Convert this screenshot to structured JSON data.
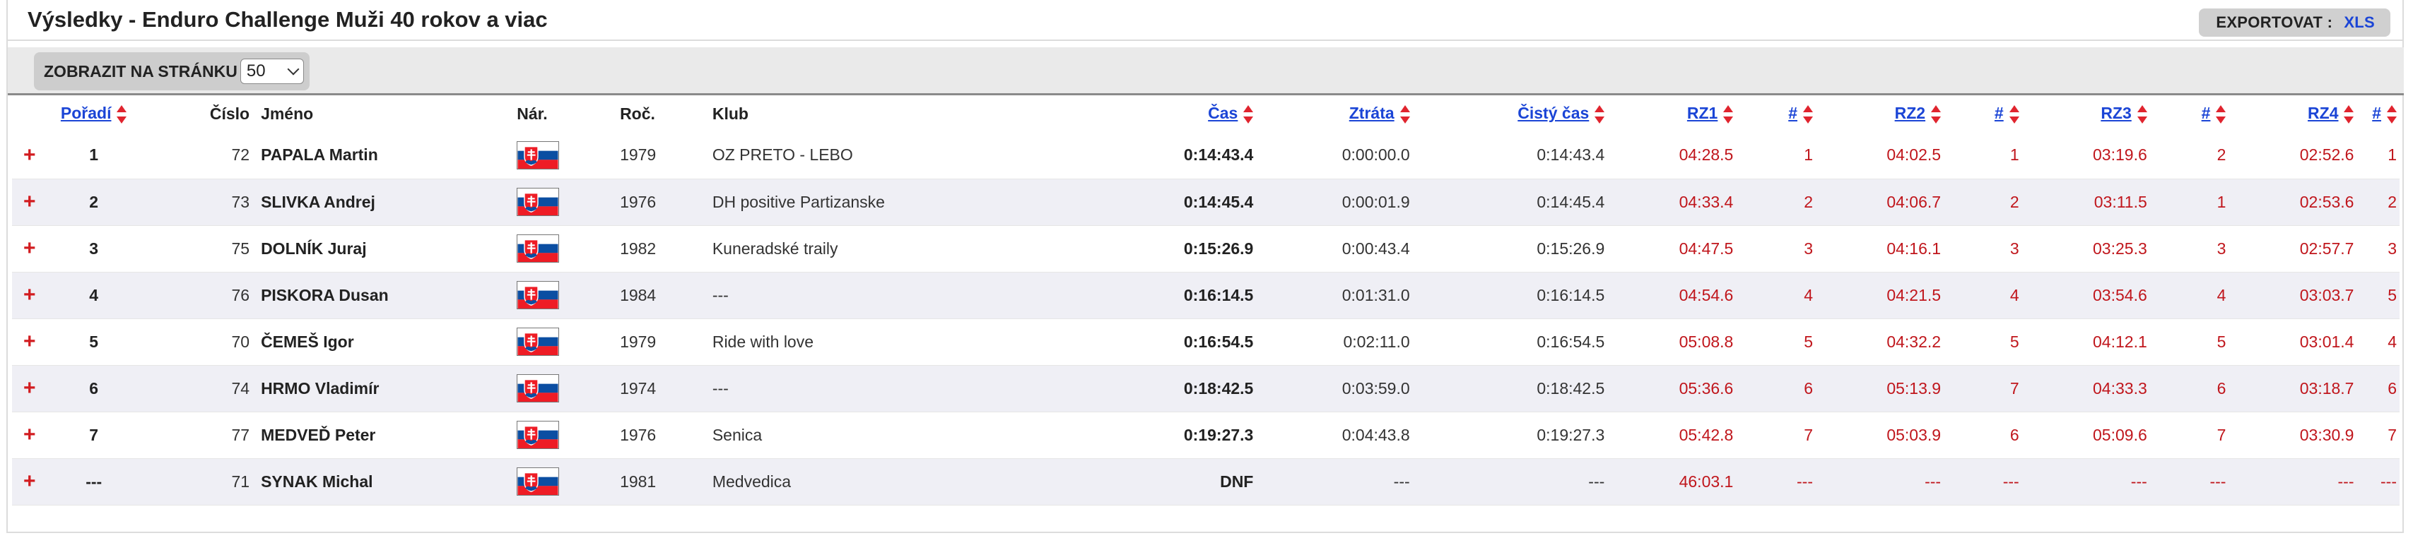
{
  "page": {
    "title": "Výsledky - Enduro Challenge Muži 40 rokov a viac"
  },
  "export": {
    "label": "EXPORTOVAT :",
    "xls": "XLS"
  },
  "toolbar": {
    "perpage_label": "ZOBRAZIT NA STRÁNKU",
    "perpage_value": "50"
  },
  "columns": {
    "poradi": "Pořadí",
    "cislo": "Číslo",
    "jmeno": "Jméno",
    "nar": "Nár.",
    "roc": "Roč.",
    "klub": "Klub",
    "cas": "Čas",
    "ztrata": "Ztráta",
    "cisty": "Čistý čas",
    "rz1": "RZ1",
    "rz2": "RZ2",
    "rz3": "RZ3",
    "rz4": "RZ4",
    "hash": "#"
  },
  "expand_symbol": "+",
  "rows": [
    {
      "rank": "1",
      "number": "72",
      "name": "PAPALA Martin",
      "nat": "svk-flag",
      "year": "1979",
      "club": "OZ PRETO - LEBO",
      "time": "0:14:43.4",
      "loss": "0:00:00.0",
      "clean": "0:14:43.4",
      "rz1": "04:28.5",
      "p1": "1",
      "rz2": "04:02.5",
      "p2": "1",
      "rz3": "03:19.6",
      "p3": "2",
      "rz4": "02:52.6",
      "p4": "1"
    },
    {
      "rank": "2",
      "number": "73",
      "name": "SLIVKA Andrej",
      "nat": "svk-flag",
      "year": "1976",
      "club": "DH positive Partizanske",
      "time": "0:14:45.4",
      "loss": "0:00:01.9",
      "clean": "0:14:45.4",
      "rz1": "04:33.4",
      "p1": "2",
      "rz2": "04:06.7",
      "p2": "2",
      "rz3": "03:11.5",
      "p3": "1",
      "rz4": "02:53.6",
      "p4": "2"
    },
    {
      "rank": "3",
      "number": "75",
      "name": "DOLNÍK Juraj",
      "nat": "svk-flag",
      "year": "1982",
      "club": "Kuneradské traily",
      "time": "0:15:26.9",
      "loss": "0:00:43.4",
      "clean": "0:15:26.9",
      "rz1": "04:47.5",
      "p1": "3",
      "rz2": "04:16.1",
      "p2": "3",
      "rz3": "03:25.3",
      "p3": "3",
      "rz4": "02:57.7",
      "p4": "3"
    },
    {
      "rank": "4",
      "number": "76",
      "name": "PISKORA Dusan",
      "nat": "svk-flag",
      "year": "1984",
      "club": "---",
      "time": "0:16:14.5",
      "loss": "0:01:31.0",
      "clean": "0:16:14.5",
      "rz1": "04:54.6",
      "p1": "4",
      "rz2": "04:21.5",
      "p2": "4",
      "rz3": "03:54.6",
      "p3": "4",
      "rz4": "03:03.7",
      "p4": "5"
    },
    {
      "rank": "5",
      "number": "70",
      "name": "ČEMEŠ Igor",
      "nat": "svk-flag",
      "year": "1979",
      "club": "Ride with love",
      "time": "0:16:54.5",
      "loss": "0:02:11.0",
      "clean": "0:16:54.5",
      "rz1": "05:08.8",
      "p1": "5",
      "rz2": "04:32.2",
      "p2": "5",
      "rz3": "04:12.1",
      "p3": "5",
      "rz4": "03:01.4",
      "p4": "4"
    },
    {
      "rank": "6",
      "number": "74",
      "name": "HRMO Vladimír",
      "nat": "svk-flag",
      "year": "1974",
      "club": "---",
      "time": "0:18:42.5",
      "loss": "0:03:59.0",
      "clean": "0:18:42.5",
      "rz1": "05:36.6",
      "p1": "6",
      "rz2": "05:13.9",
      "p2": "7",
      "rz3": "04:33.3",
      "p3": "6",
      "rz4": "03:18.7",
      "p4": "6"
    },
    {
      "rank": "7",
      "number": "77",
      "name": "MEDVEĎ Peter",
      "nat": "svk-flag",
      "year": "1976",
      "club": "Senica",
      "time": "0:19:27.3",
      "loss": "0:04:43.8",
      "clean": "0:19:27.3",
      "rz1": "05:42.8",
      "p1": "7",
      "rz2": "05:03.9",
      "p2": "6",
      "rz3": "05:09.6",
      "p3": "7",
      "rz4": "03:30.9",
      "p4": "7"
    },
    {
      "rank": "---",
      "number": "71",
      "name": "SYNAK Michal",
      "nat": "svk-flag",
      "year": "1981",
      "club": "Medvedica",
      "time": "DNF",
      "loss": "---",
      "clean": "---",
      "rz1": "46:03.1",
      "p1": "---",
      "rz2": "---",
      "p2": "---",
      "rz3": "---",
      "p3": "---",
      "rz4": "---",
      "p4": "---"
    }
  ]
}
